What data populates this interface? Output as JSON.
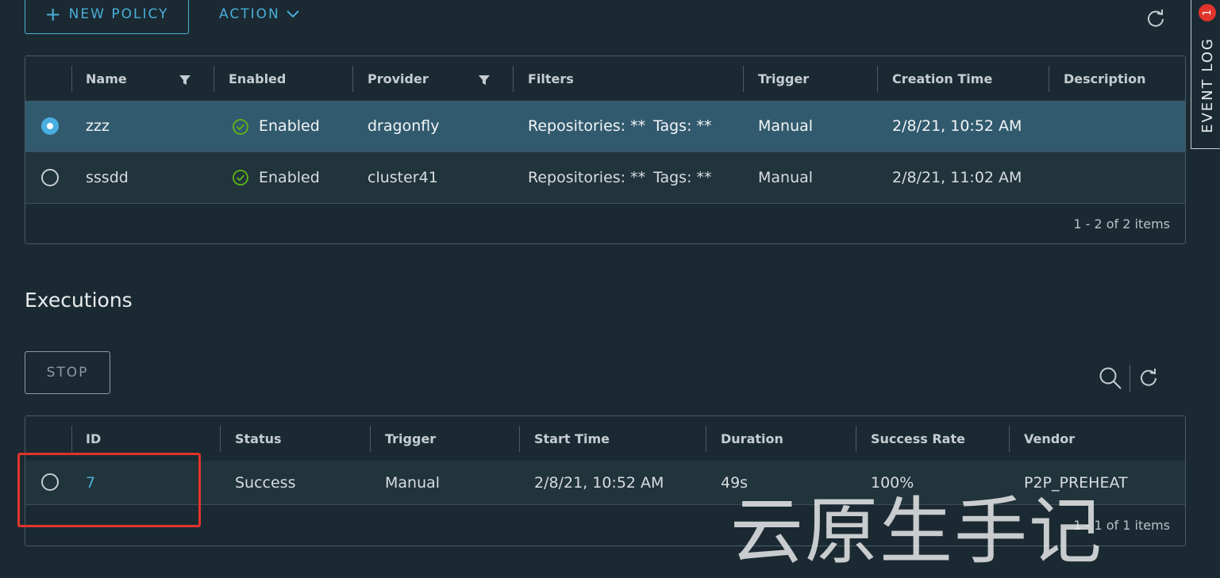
{
  "toolbar": {
    "new_policy_label": "NEW POLICY",
    "action_label": "ACTION"
  },
  "policies": {
    "columns": [
      "Name",
      "Enabled",
      "Provider",
      "Filters",
      "Trigger",
      "Creation Time",
      "Description"
    ],
    "rows": [
      {
        "name": "zzz",
        "enabled": "Enabled",
        "provider": "dragonfly",
        "filters_repo": "Repositories: **",
        "filters_tags": "Tags: **",
        "trigger": "Manual",
        "creation_time": "2/8/21, 10:52 AM",
        "description": "",
        "selected": true
      },
      {
        "name": "sssdd",
        "enabled": "Enabled",
        "provider": "cluster41",
        "filters_repo": "Repositories: **",
        "filters_tags": "Tags: **",
        "trigger": "Manual",
        "creation_time": "2/8/21, 11:02 AM",
        "description": "",
        "selected": false
      }
    ],
    "footer": "1 - 2 of 2 items"
  },
  "executions": {
    "title": "Executions",
    "stop_label": "STOP",
    "columns": [
      "ID",
      "Status",
      "Trigger",
      "Start Time",
      "Duration",
      "Success Rate",
      "Vendor"
    ],
    "rows": [
      {
        "id": "7",
        "status": "Success",
        "trigger": "Manual",
        "start_time": "2/8/21, 10:52 AM",
        "duration": "49s",
        "success_rate": "100%",
        "vendor": "P2P_PREHEAT"
      }
    ],
    "footer": "1 - 1 of 1 items"
  },
  "event_log": {
    "label": "EVENT LOG",
    "count": "1"
  },
  "watermark": "云原生手记",
  "colors": {
    "accent": "#4aaed9",
    "background": "#1b2a32",
    "selected_row": "#325a6e",
    "success": "#5eb715",
    "highlight_box": "#e0342c",
    "badge": "#e0342c"
  }
}
